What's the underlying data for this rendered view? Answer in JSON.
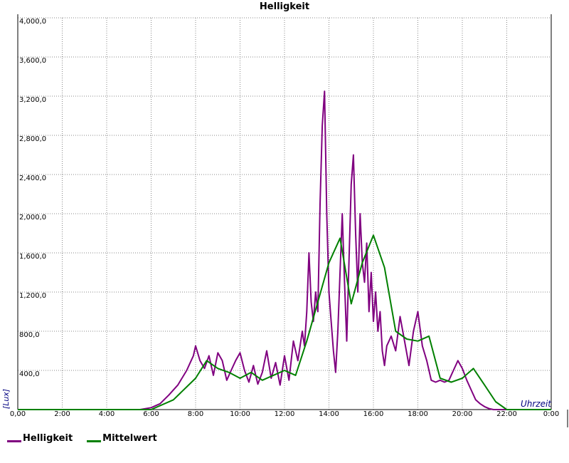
{
  "chart_data": {
    "type": "line",
    "title": "Helligkeit",
    "ylabel": "[Lux]",
    "xlabel": "Uhrzeit",
    "xlim": [
      0,
      24
    ],
    "ylim": [
      0,
      4000
    ],
    "x_ticks": [
      "0,00",
      "2:00",
      "4:00",
      "6:00",
      "8:00",
      "10:00",
      "12:00",
      "14:00",
      "16:00",
      "18:00",
      "20:00",
      "22:00",
      "0:00"
    ],
    "y_ticks": [
      "400,0",
      "800,0",
      "1,200,0",
      "1,600,0",
      "2,000,0",
      "2,400,0",
      "2,800,0",
      "3,200,0",
      "3,600,0",
      "4,000,0"
    ],
    "y_tick_values": [
      400,
      800,
      1200,
      1600,
      2000,
      2400,
      2800,
      3200,
      3600,
      4000
    ],
    "grid": true,
    "legend_position": "bottom-left",
    "series": [
      {
        "name": "Helligkeit",
        "color": "#800080",
        "x": [
          0,
          5.5,
          6.0,
          6.4,
          6.8,
          7.2,
          7.6,
          7.9,
          8.0,
          8.2,
          8.4,
          8.6,
          8.8,
          9.0,
          9.2,
          9.4,
          9.6,
          9.8,
          10.0,
          10.2,
          10.4,
          10.6,
          10.8,
          11.0,
          11.2,
          11.4,
          11.6,
          11.8,
          12.0,
          12.2,
          12.4,
          12.6,
          12.8,
          12.9,
          13.0,
          13.1,
          13.2,
          13.3,
          13.4,
          13.5,
          13.6,
          13.7,
          13.8,
          13.9,
          14.0,
          14.1,
          14.2,
          14.3,
          14.4,
          14.5,
          14.6,
          14.7,
          14.8,
          14.9,
          15.0,
          15.1,
          15.2,
          15.3,
          15.4,
          15.5,
          15.6,
          15.7,
          15.8,
          15.9,
          16.0,
          16.1,
          16.2,
          16.3,
          16.4,
          16.5,
          16.6,
          16.7,
          16.8,
          17.0,
          17.2,
          17.4,
          17.6,
          17.8,
          18.0,
          18.2,
          18.4,
          18.6,
          18.8,
          19.0,
          19.2,
          19.4,
          19.6,
          19.8,
          20.0,
          20.2,
          20.4,
          20.6,
          20.8,
          21.0,
          21.2,
          21.4,
          21.6,
          22.0,
          24.0
        ],
        "values": [
          0,
          0,
          20,
          60,
          150,
          250,
          400,
          550,
          650,
          500,
          420,
          550,
          350,
          580,
          500,
          300,
          400,
          500,
          580,
          400,
          280,
          450,
          260,
          380,
          600,
          320,
          480,
          250,
          550,
          300,
          700,
          500,
          800,
          650,
          1000,
          1600,
          1100,
          900,
          1200,
          1000,
          2100,
          2900,
          3250,
          2000,
          1200,
          900,
          600,
          380,
          800,
          1400,
          2000,
          1300,
          700,
          1500,
          2300,
          2600,
          1800,
          1200,
          2000,
          1500,
          1300,
          1700,
          1000,
          1400,
          900,
          1200,
          800,
          1000,
          600,
          450,
          650,
          700,
          750,
          600,
          950,
          700,
          450,
          800,
          1000,
          650,
          500,
          300,
          280,
          300,
          280,
          300,
          400,
          500,
          420,
          300,
          200,
          100,
          60,
          30,
          10,
          0,
          0,
          0,
          0
        ]
      },
      {
        "name": "Mittelwert",
        "color": "#008000",
        "x": [
          0,
          6.0,
          7.0,
          8.0,
          8.5,
          9.0,
          9.5,
          10.0,
          10.5,
          11.0,
          11.5,
          12.0,
          12.5,
          13.0,
          13.5,
          14.0,
          14.5,
          15.0,
          15.5,
          16.0,
          16.5,
          17.0,
          17.5,
          18.0,
          18.5,
          19.0,
          19.5,
          20.0,
          20.5,
          21.0,
          21.5,
          22.0,
          24.0
        ],
        "values": [
          0,
          0,
          100,
          320,
          500,
          420,
          380,
          320,
          380,
          300,
          350,
          400,
          350,
          700,
          1100,
          1500,
          1750,
          1080,
          1500,
          1780,
          1450,
          800,
          720,
          700,
          750,
          320,
          280,
          320,
          420,
          250,
          80,
          0,
          0
        ]
      }
    ]
  }
}
